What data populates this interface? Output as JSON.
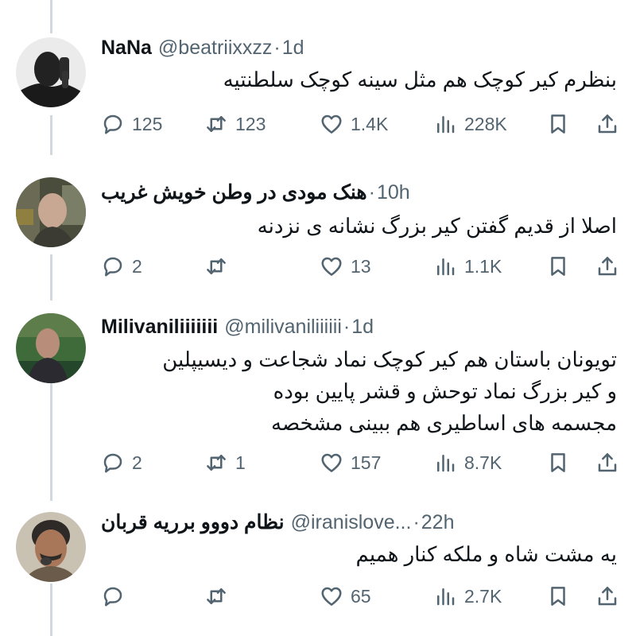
{
  "posts": [
    {
      "name": "NaNa",
      "handle": "@beatriixxzz",
      "separator": "·",
      "time": "1d",
      "lines": [
        "بنظرم کیر کوچک هم مثل سینه کوچک سلطنتیه"
      ],
      "replies": "125",
      "reposts": "123",
      "likes": "1.4K",
      "views": "228K"
    },
    {
      "name": "هنک مودی در وطن خویش غریب",
      "handle": "",
      "separator": "·",
      "time": "10h",
      "lines": [
        "اصلا از قدیم گفتن کیر بزرگ نشانه ی نزدنه"
      ],
      "replies": "2",
      "reposts": "",
      "likes": "13",
      "views": "1.1K"
    },
    {
      "name": "Milivaniliiiiiii",
      "handle": "@milivaniliiiiii",
      "separator": "·",
      "time": "1d",
      "lines": [
        "تویونان باستان هم کیر کوچک نماد شجاعت و دیسیپلین",
        "و کیر بزرگ نماد توحش و قشر پایین بوده",
        "مجسمه های اساطیری هم ببینی مشخصه"
      ],
      "replies": "2",
      "reposts": "1",
      "likes": "157",
      "views": "8.7K"
    },
    {
      "name": "نظام دووو برریه قربان",
      "handle": "@iranislove...",
      "separator": "·",
      "time": "22h",
      "lines": [
        "یه مشت شاه و ملکه کنار همیم"
      ],
      "replies": "",
      "reposts": "",
      "likes": "65",
      "views": "2.7K"
    }
  ],
  "icons": {
    "reply": "reply-icon",
    "repost": "repost-icon",
    "like": "heart-icon",
    "views": "views-icon",
    "bookmark": "bookmark-icon",
    "share": "share-icon"
  },
  "colors": {
    "text": "#0f1419",
    "muted": "#536471",
    "thread_line": "#cfd9de"
  }
}
